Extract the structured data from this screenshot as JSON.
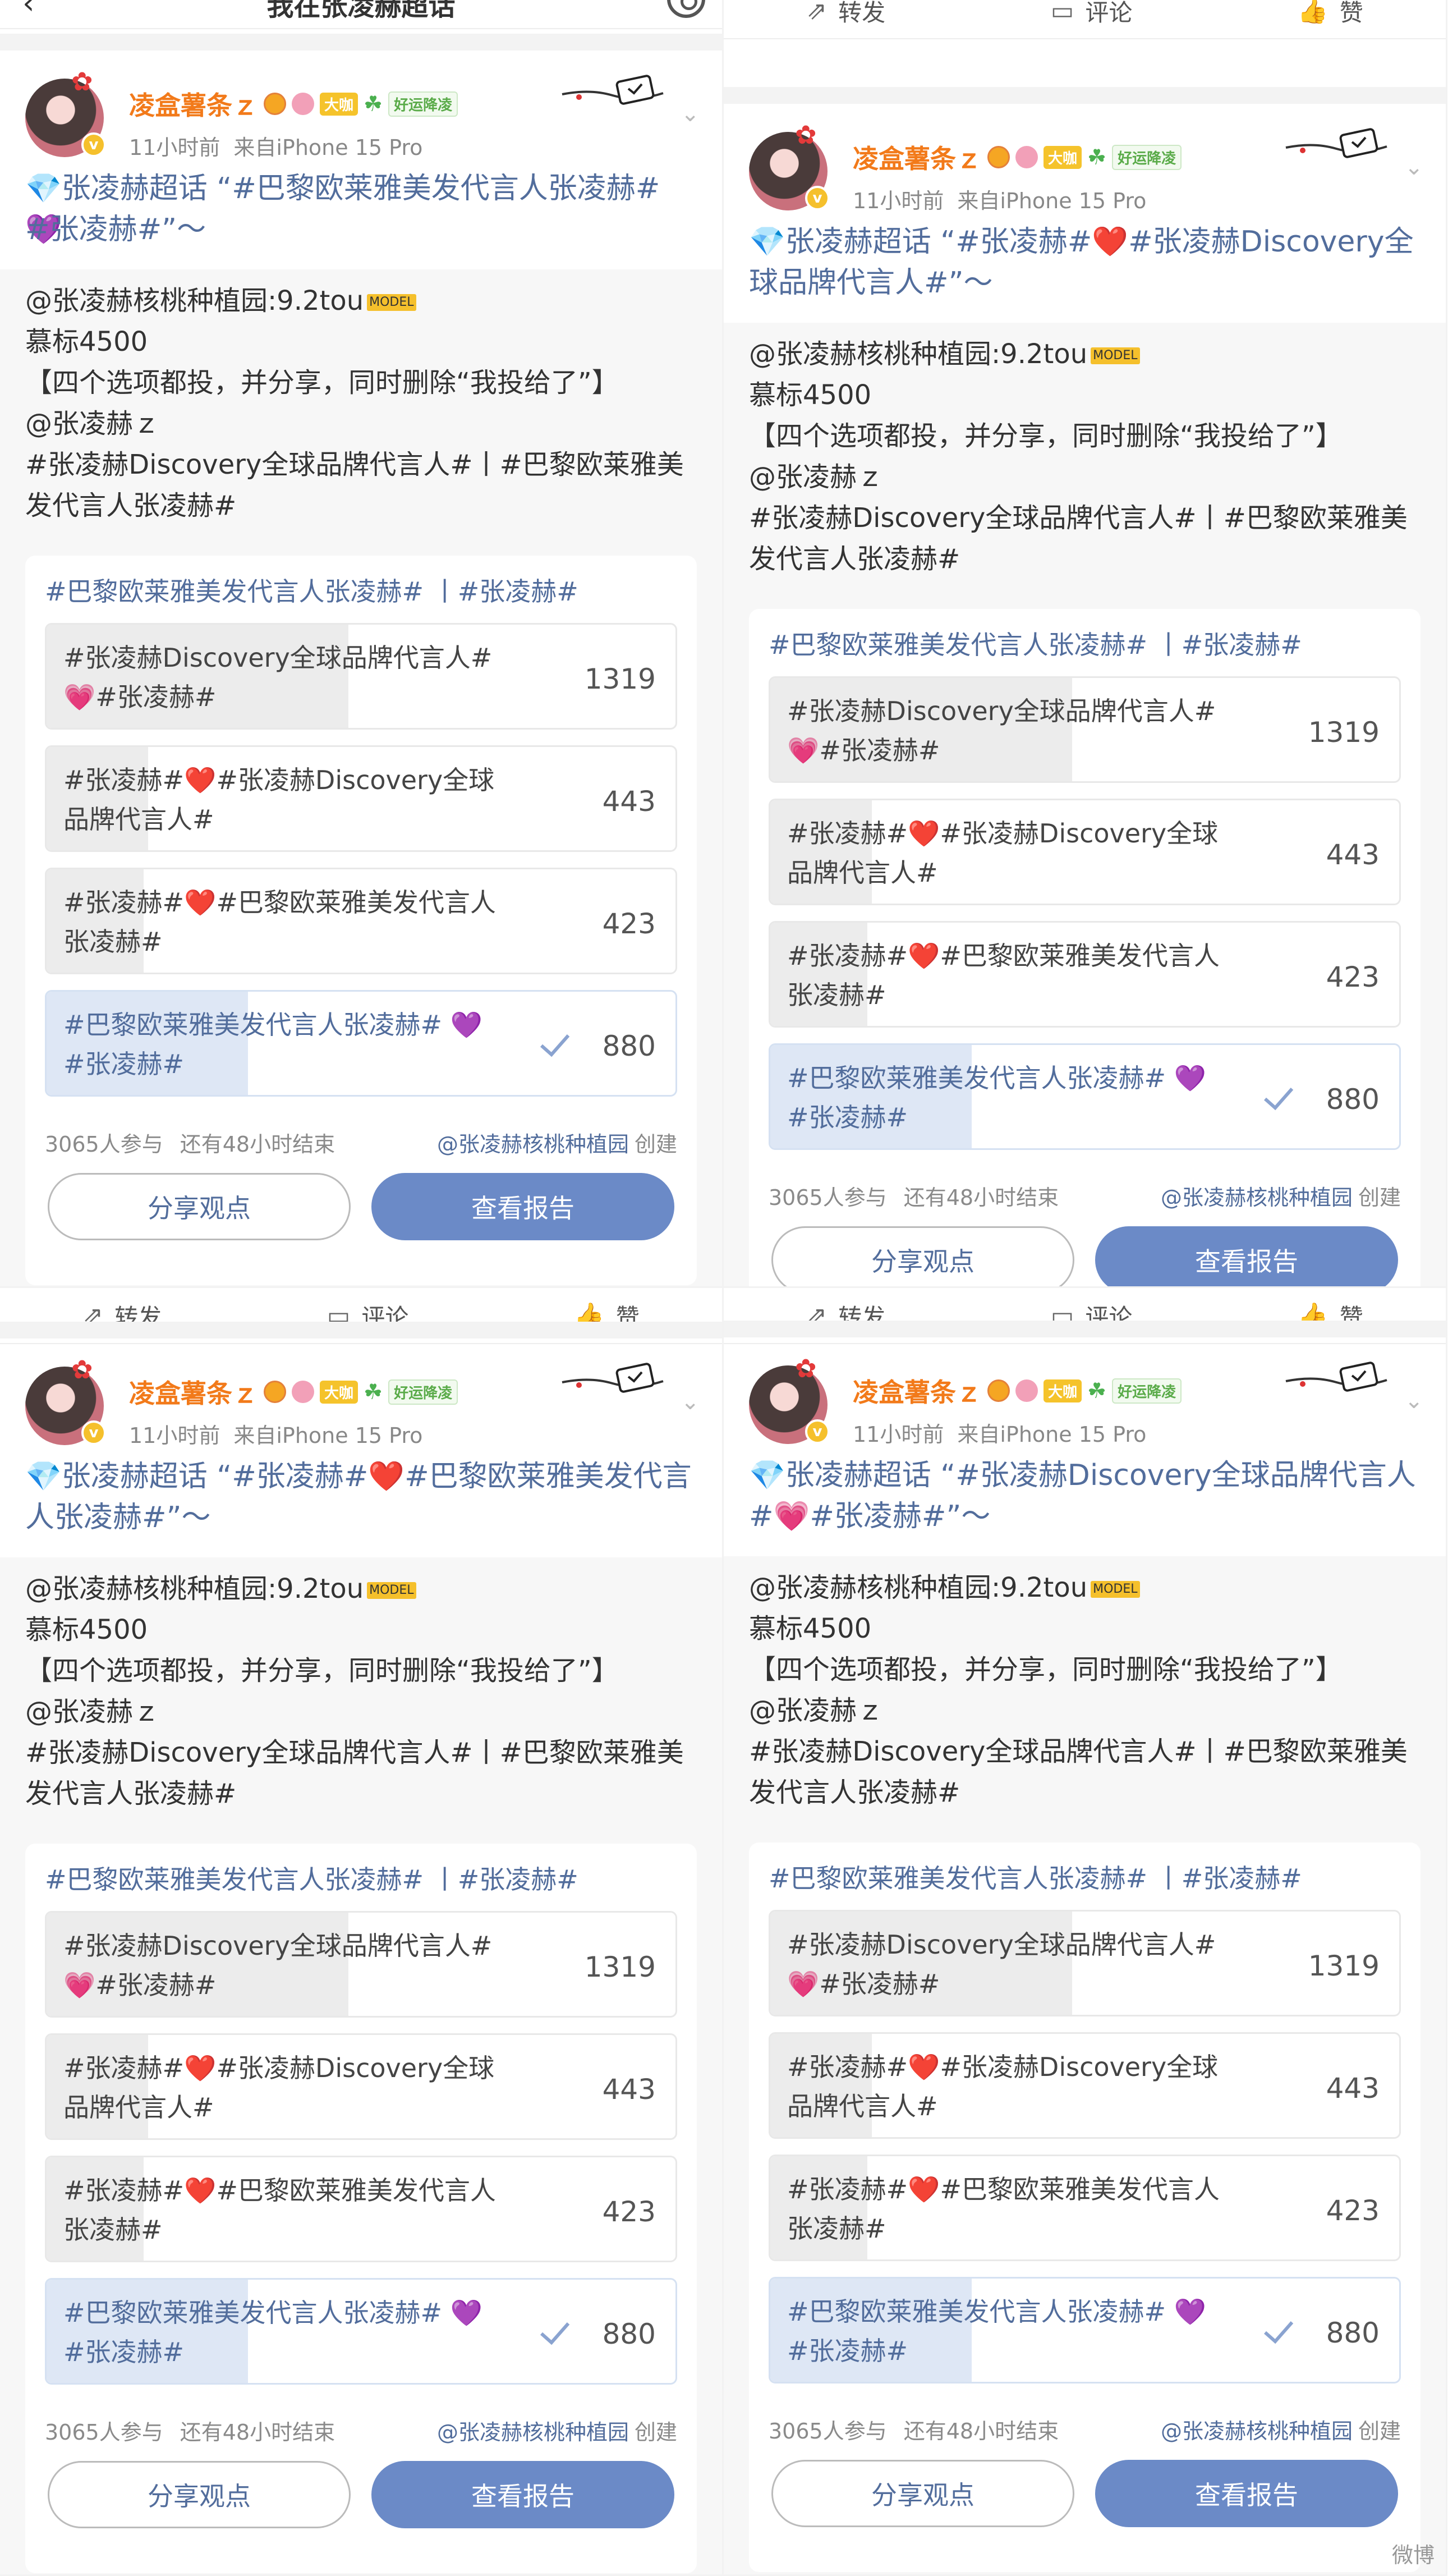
{
  "page": {
    "title": "我在张凌赫超话"
  },
  "actions": {
    "repost": "转发",
    "comment": "评论",
    "like": "赞"
  },
  "user": {
    "name": "凌盒薯条ｚ",
    "badge_big": "大咖",
    "badge_luck": "好运降凌",
    "time": "11小时前",
    "source": "来自iPhone 15 Pro",
    "verify_mark": "v"
  },
  "repost": {
    "line1": "@张凌赫核桃种植园:9.2tou",
    "mo_icon": "MODEL",
    "line2": "慕标4500",
    "line3": "【四个选项都投，并分享，同时删除“我投给了”】",
    "line4": "@张凌赫ｚ",
    "line5": "#张凌赫Discovery全球品牌代言人#丨#巴黎欧莱雅美",
    "line6": "发代言人张凌赫#"
  },
  "posts": [
    {
      "line1": "💎张凌赫超话 “#巴黎欧莱雅美发代言人张凌赫# 💜",
      "line2": "#张凌赫#”～"
    },
    {
      "line1": "💎张凌赫超话 “#张凌赫#❤️#张凌赫Discovery全",
      "line2": "球品牌代言人#”～"
    },
    {
      "line1": "💎张凌赫超话 “#张凌赫#❤️#巴黎欧莱雅美发代言",
      "line2": "人张凌赫#”～"
    },
    {
      "line1": "💎张凌赫超话 “#张凌赫Discovery全球品牌代言人",
      "line2": "#💗#张凌赫#”～"
    }
  ],
  "poll": {
    "title": "#巴黎欧莱雅美发代言人张凌赫# 丨#张凌赫#",
    "options": [
      {
        "line1": "#张凌赫Discovery全球品牌代言人#",
        "line2": "💗#张凌赫#",
        "votes": "1319",
        "share": 1.0,
        "selected": false
      },
      {
        "line1": "#张凌赫#❤️#张凌赫Discovery全球",
        "line2": "品牌代言人#",
        "votes": "443",
        "share": 0.3359,
        "selected": false
      },
      {
        "line1": "#张凌赫#❤️#巴黎欧莱雅美发代言人",
        "line2": "张凌赫#",
        "votes": "423",
        "share": 0.3207,
        "selected": false
      },
      {
        "line1": "#巴黎欧莱雅美发代言人张凌赫# 💜",
        "line2": "#张凌赫#",
        "votes": "880",
        "share": 0.6672,
        "selected": true
      }
    ],
    "participants": "3065人参与",
    "ends": "还有48小时结束",
    "creator": "@张凌赫核桃种植园",
    "created": "创建",
    "share_label": "分享观点",
    "report_label": "查看报告"
  },
  "watermark": "微博",
  "colors": {
    "link": "#526d9c",
    "accent_button": "#6b8ac7",
    "username": "#f27a1a"
  }
}
